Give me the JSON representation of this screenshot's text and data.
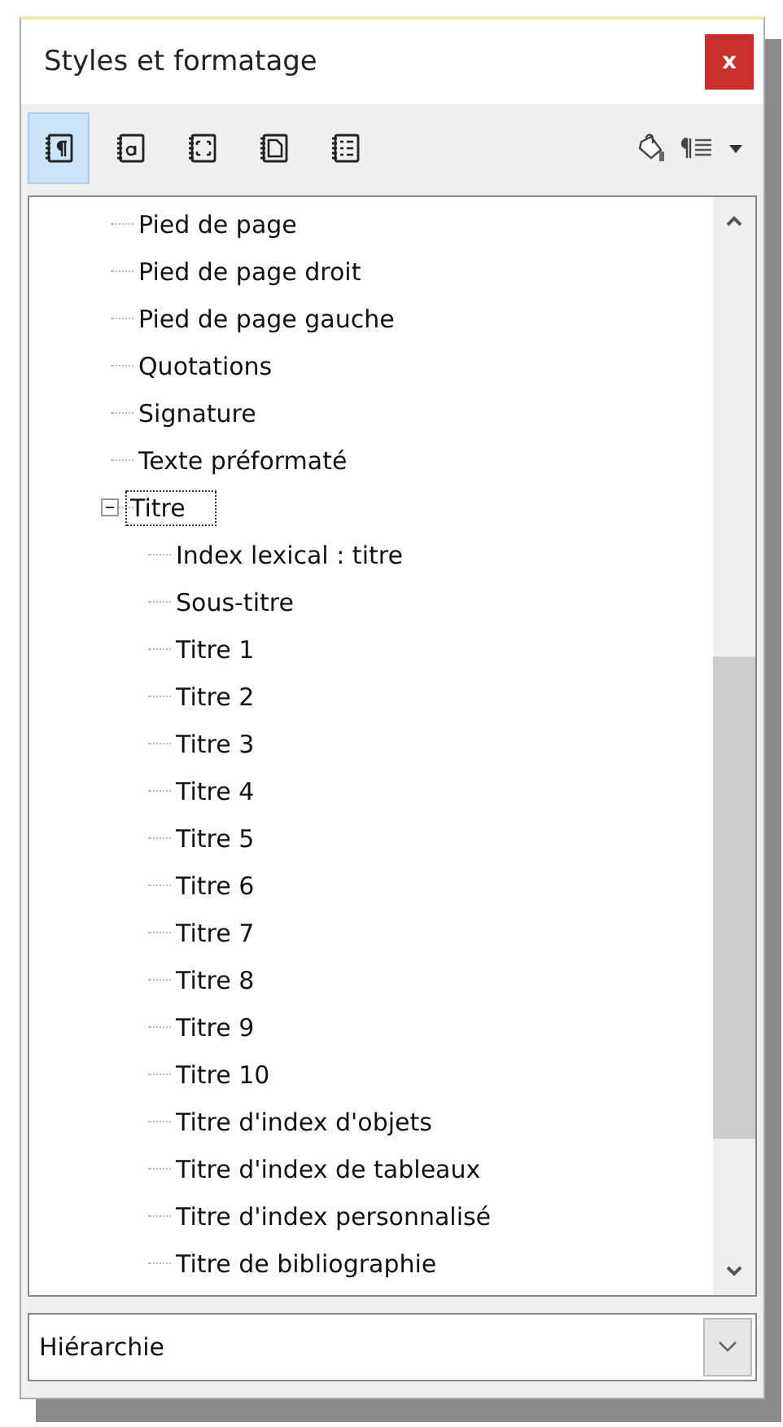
{
  "window": {
    "title": "Styles et formatage",
    "close": "x"
  },
  "toolbar": {
    "families": [
      {
        "selected": true
      },
      {
        "selected": false
      },
      {
        "selected": false
      },
      {
        "selected": false
      },
      {
        "selected": false
      }
    ]
  },
  "tree": [
    {
      "label": "Pied de page"
    },
    {
      "label": "Pied de page droit"
    },
    {
      "label": "Pied de page gauche"
    },
    {
      "label": "Quotations"
    },
    {
      "label": "Signature"
    },
    {
      "label": "Texte préformaté"
    },
    {
      "label": "Titre",
      "expanded": true,
      "focused": true,
      "children": [
        {
          "label": "Index lexical : titre"
        },
        {
          "label": "Sous-titre"
        },
        {
          "label": "Titre 1"
        },
        {
          "label": "Titre 2"
        },
        {
          "label": "Titre 3"
        },
        {
          "label": "Titre 4"
        },
        {
          "label": "Titre 5"
        },
        {
          "label": "Titre 6"
        },
        {
          "label": "Titre 7"
        },
        {
          "label": "Titre 8"
        },
        {
          "label": "Titre 9"
        },
        {
          "label": "Titre 10"
        },
        {
          "label": "Titre d'index d'objets"
        },
        {
          "label": "Titre d'index de tableaux"
        },
        {
          "label": "Titre d'index personnalisé"
        },
        {
          "label": "Titre de bibliographie"
        }
      ]
    }
  ],
  "filter": {
    "value": "Hiérarchie"
  }
}
